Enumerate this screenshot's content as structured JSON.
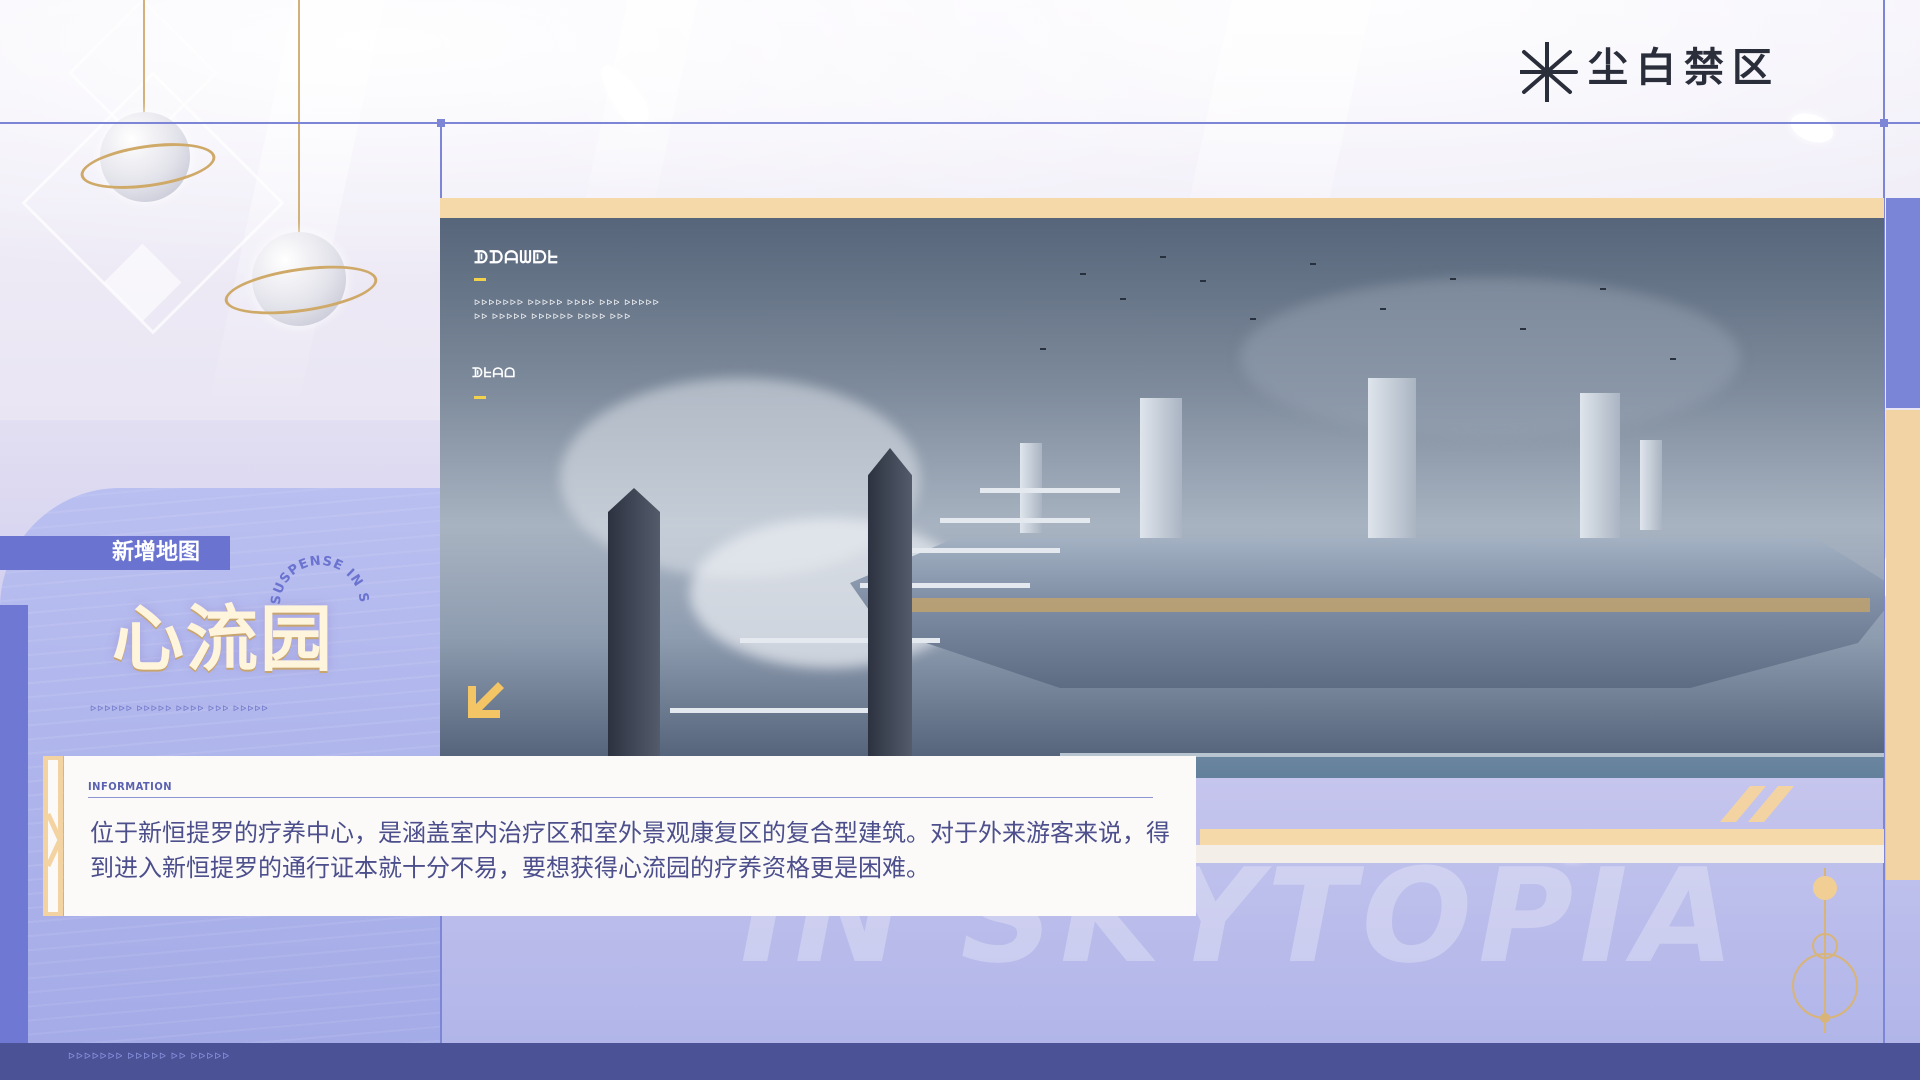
{
  "brand": {
    "logo_text": "尘白禁区"
  },
  "map_intro": {
    "tag_label": "新增地图",
    "map_name": "心流园",
    "curved_caption": "SUSPENSE IN SKY",
    "sub_code": "ᐅᐅᐅᐅᐅᐅ ᐅᐅᐅᐅᐅ ᐅᐅᐅᐅ ᐅᐅᐅ ᐅᐅᐅᐅᐅ"
  },
  "screenshot_overlay": {
    "title_glyphs": "ᗫᗪᗩᗯᗟᖶ",
    "line1_glyphs": "ᐅᐅᐅᐅᐅᐅᐅ ᐅᐅᐅᐅᐅ ᐅᐅᐅᐅ ᐅᐅᐅ ᐅᐅᐅᐅᐅ",
    "line2_glyphs": "ᐅᐅ ᐅᐅᐅᐅᐅ ᐅᐅᐅᐅᐅᐅ ᐅᐅᐅᐅ ᐅᐅᐅ",
    "section2_glyphs": "ᗫᖶᗩᗝ"
  },
  "info": {
    "label": "INFORMATION",
    "description": "位于新恒提罗的疗养中心，是涵盖室内治疗区和室外景观康复区的复合型建筑。对于外来游客来说，得到进入新恒提罗的通行证本就十分不易，要想获得心流园的疗养资格更是困难。"
  },
  "watermark_text": "IN SKYTOPIA",
  "bottom_code": "ᐅᐅᐅᐅᐅᐅᐅ ᐅᐅᐅᐅᐅ ᐅᐅ ᐅᐅᐅᐅᐅ",
  "colors": {
    "accent_purple": "#6a73cf",
    "accent_gold": "#f4d3a2",
    "text_indigo": "#4c4f8c",
    "bottom_bar": "#4b5296"
  }
}
